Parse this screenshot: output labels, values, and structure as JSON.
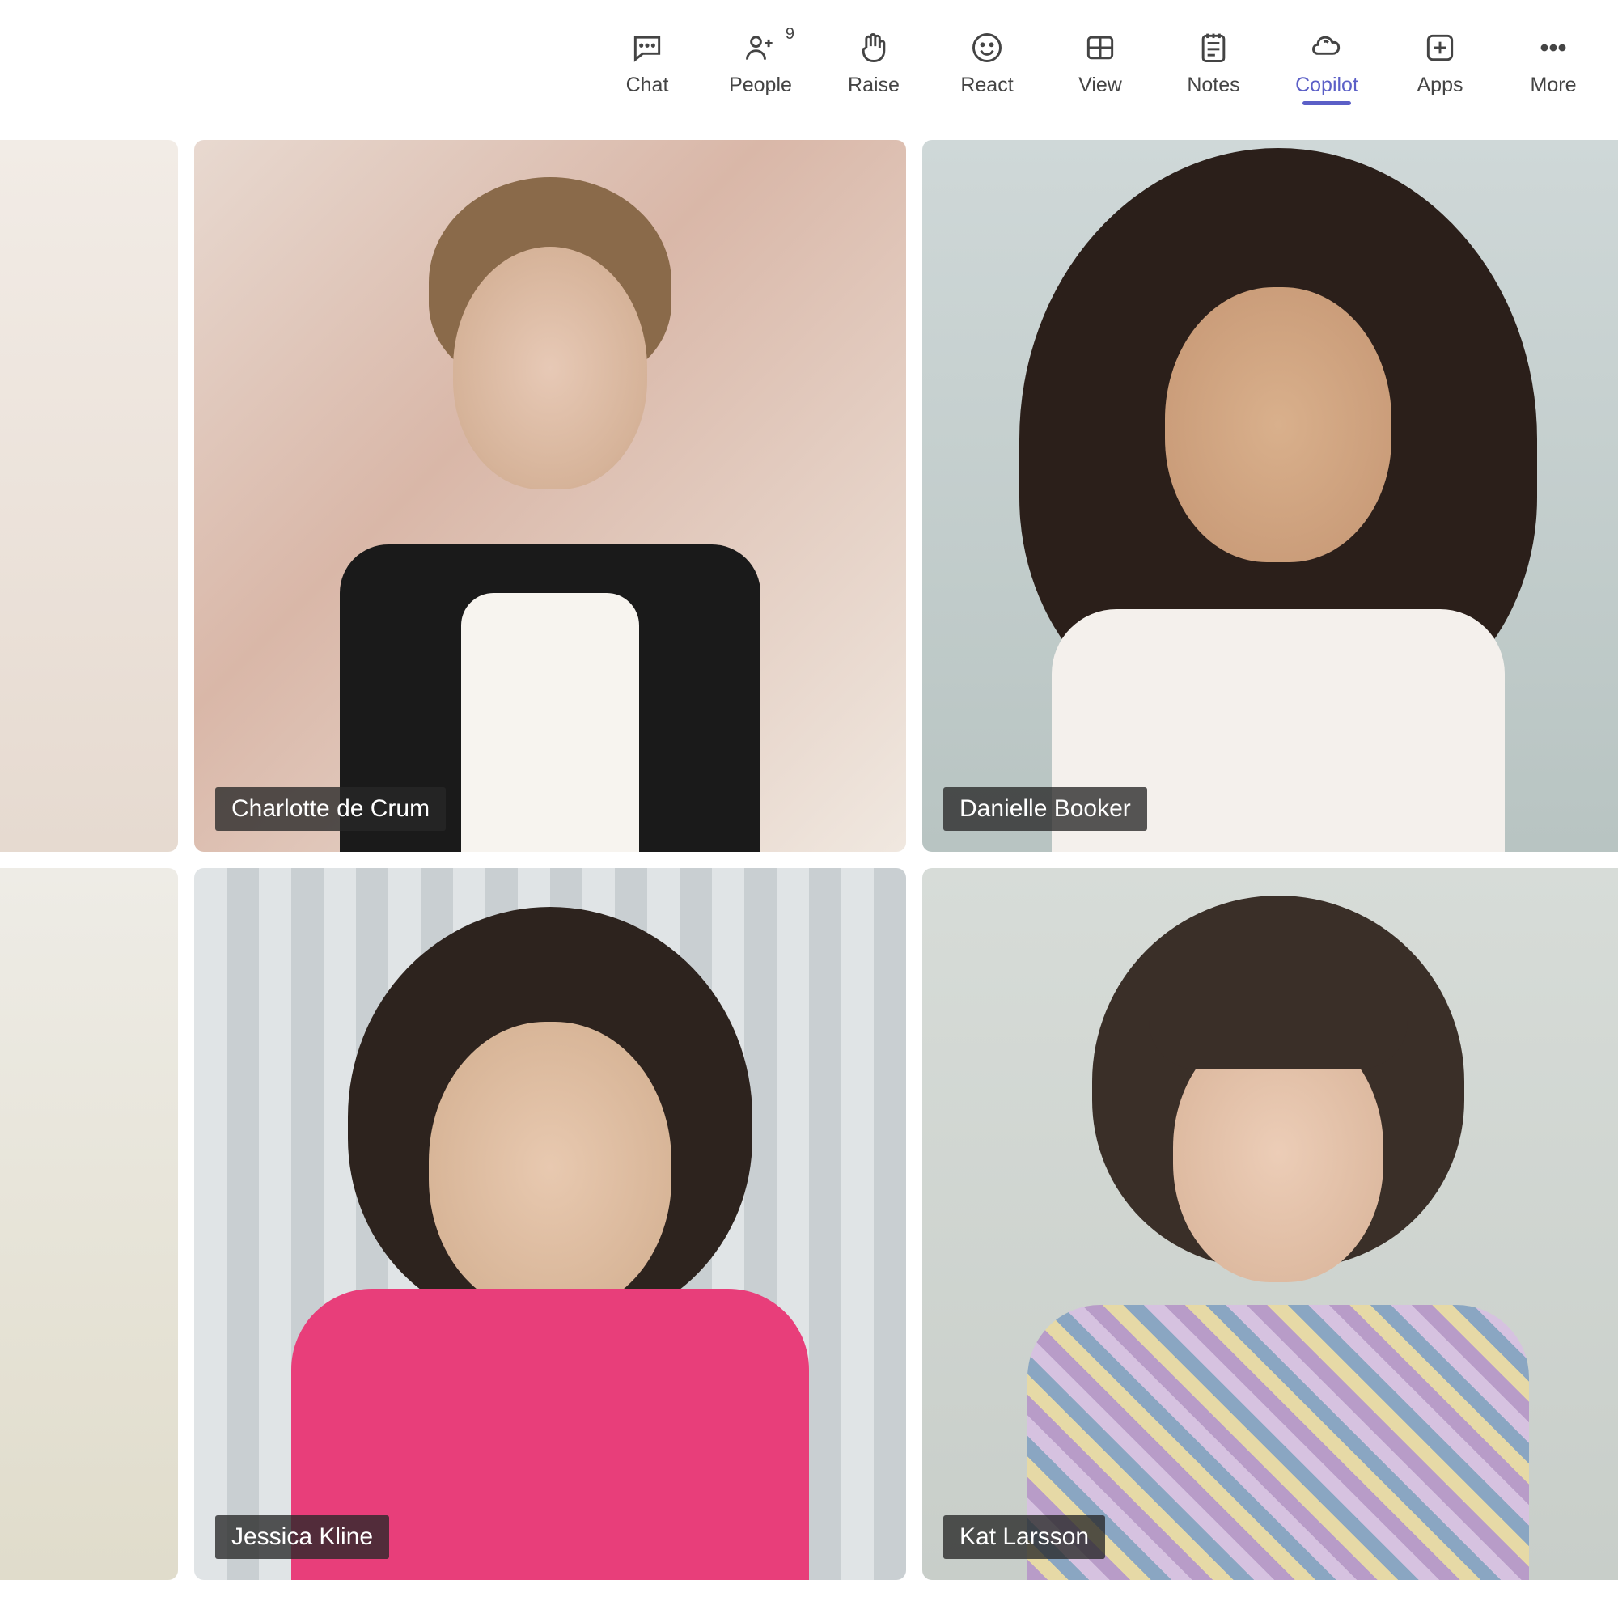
{
  "toolbar": {
    "items": [
      {
        "id": "chat",
        "label": "Chat",
        "icon": "chat-icon",
        "badge": ""
      },
      {
        "id": "people",
        "label": "People",
        "icon": "people-icon",
        "badge": "9"
      },
      {
        "id": "raise",
        "label": "Raise",
        "icon": "raise-hand-icon",
        "badge": ""
      },
      {
        "id": "react",
        "label": "React",
        "icon": "react-icon",
        "badge": ""
      },
      {
        "id": "view",
        "label": "View",
        "icon": "view-icon",
        "badge": ""
      },
      {
        "id": "notes",
        "label": "Notes",
        "icon": "notes-icon",
        "badge": ""
      },
      {
        "id": "copilot",
        "label": "Copilot",
        "icon": "copilot-icon",
        "badge": "",
        "active": true
      },
      {
        "id": "apps",
        "label": "Apps",
        "icon": "apps-icon",
        "badge": ""
      },
      {
        "id": "more",
        "label": "More",
        "icon": "more-icon",
        "badge": ""
      }
    ]
  },
  "participants": {
    "row1": [
      {
        "name": "",
        "partial": true
      },
      {
        "name": "Charlotte de Crum"
      },
      {
        "name": "Danielle Booker"
      }
    ],
    "row2": [
      {
        "name": "",
        "partial": true
      },
      {
        "name": "Jessica Kline"
      },
      {
        "name": "Kat Larsson"
      }
    ]
  }
}
